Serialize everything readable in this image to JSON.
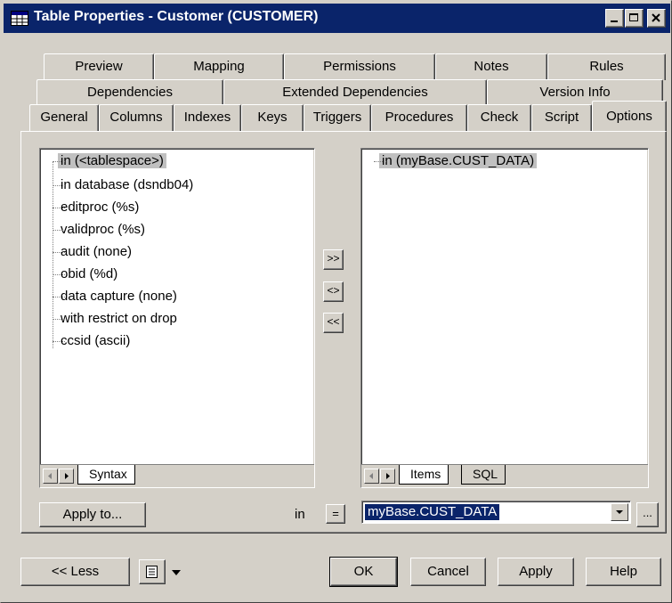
{
  "window": {
    "title": "Table Properties - Customer (CUSTOMER)"
  },
  "tabs": {
    "row1": [
      "Preview",
      "Mapping",
      "Permissions",
      "Notes",
      "Rules"
    ],
    "row2": [
      "Dependencies",
      "Extended Dependencies",
      "Version Info"
    ],
    "row3": [
      "General",
      "Columns",
      "Indexes",
      "Keys",
      "Triggers",
      "Procedures",
      "Check",
      "Script",
      "Options"
    ],
    "active": "Options"
  },
  "syntax_list": {
    "items": [
      "in (<tablespace>)",
      "in database (dsndb04)",
      "editproc (%s)",
      "validproc (%s)",
      "audit (none)",
      "obid (%d)",
      "data capture (none)",
      "with restrict on drop",
      "ccsid (ascii)"
    ],
    "selected": "in (<tablespace>)",
    "tabs": [
      "Syntax"
    ]
  },
  "items_list": {
    "items": [
      "in (myBase.CUST_DATA)"
    ],
    "tabs": [
      "Items",
      "SQL"
    ]
  },
  "transfer": {
    "add": ">>",
    "replace": "<>",
    "remove": "<<"
  },
  "apply_to": "Apply to...",
  "option_name": "in",
  "equals": "=",
  "value": "myBase.CUST_DATA",
  "ellipsis": "...",
  "footer": {
    "less": "<< Less",
    "ok": "OK",
    "cancel": "Cancel",
    "apply": "Apply",
    "help": "Help"
  },
  "colors": {
    "titlebar": "#0a246a",
    "face": "#d4d0c8",
    "selection": "#0a246a"
  }
}
